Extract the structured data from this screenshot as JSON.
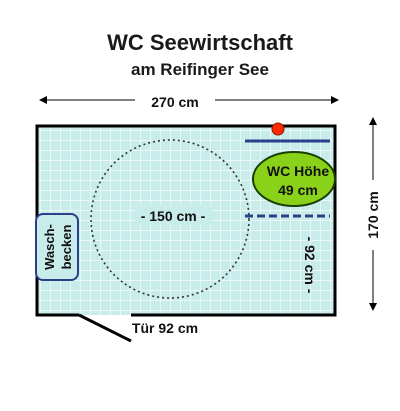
{
  "title": "WC Seewirtschaft",
  "subtitle": "am Reifinger See",
  "width_label": "270 cm",
  "depth_label": "170 cm",
  "turning_circle_label": "- 150 cm -",
  "wc_label_line1": "WC Höhe",
  "wc_label_line2": "49 cm",
  "grab_bar_distance_label": "- 92 cm -",
  "sink_label_line1": "Wasch-",
  "sink_label_line2": "becken",
  "door_label": "Tür 92 cm",
  "colors": {
    "floor": "#c7ecea",
    "wc": "#8ad11a",
    "grab_bar": "#2c3f8a",
    "button": "#ff2a00",
    "wall": "#000000"
  }
}
